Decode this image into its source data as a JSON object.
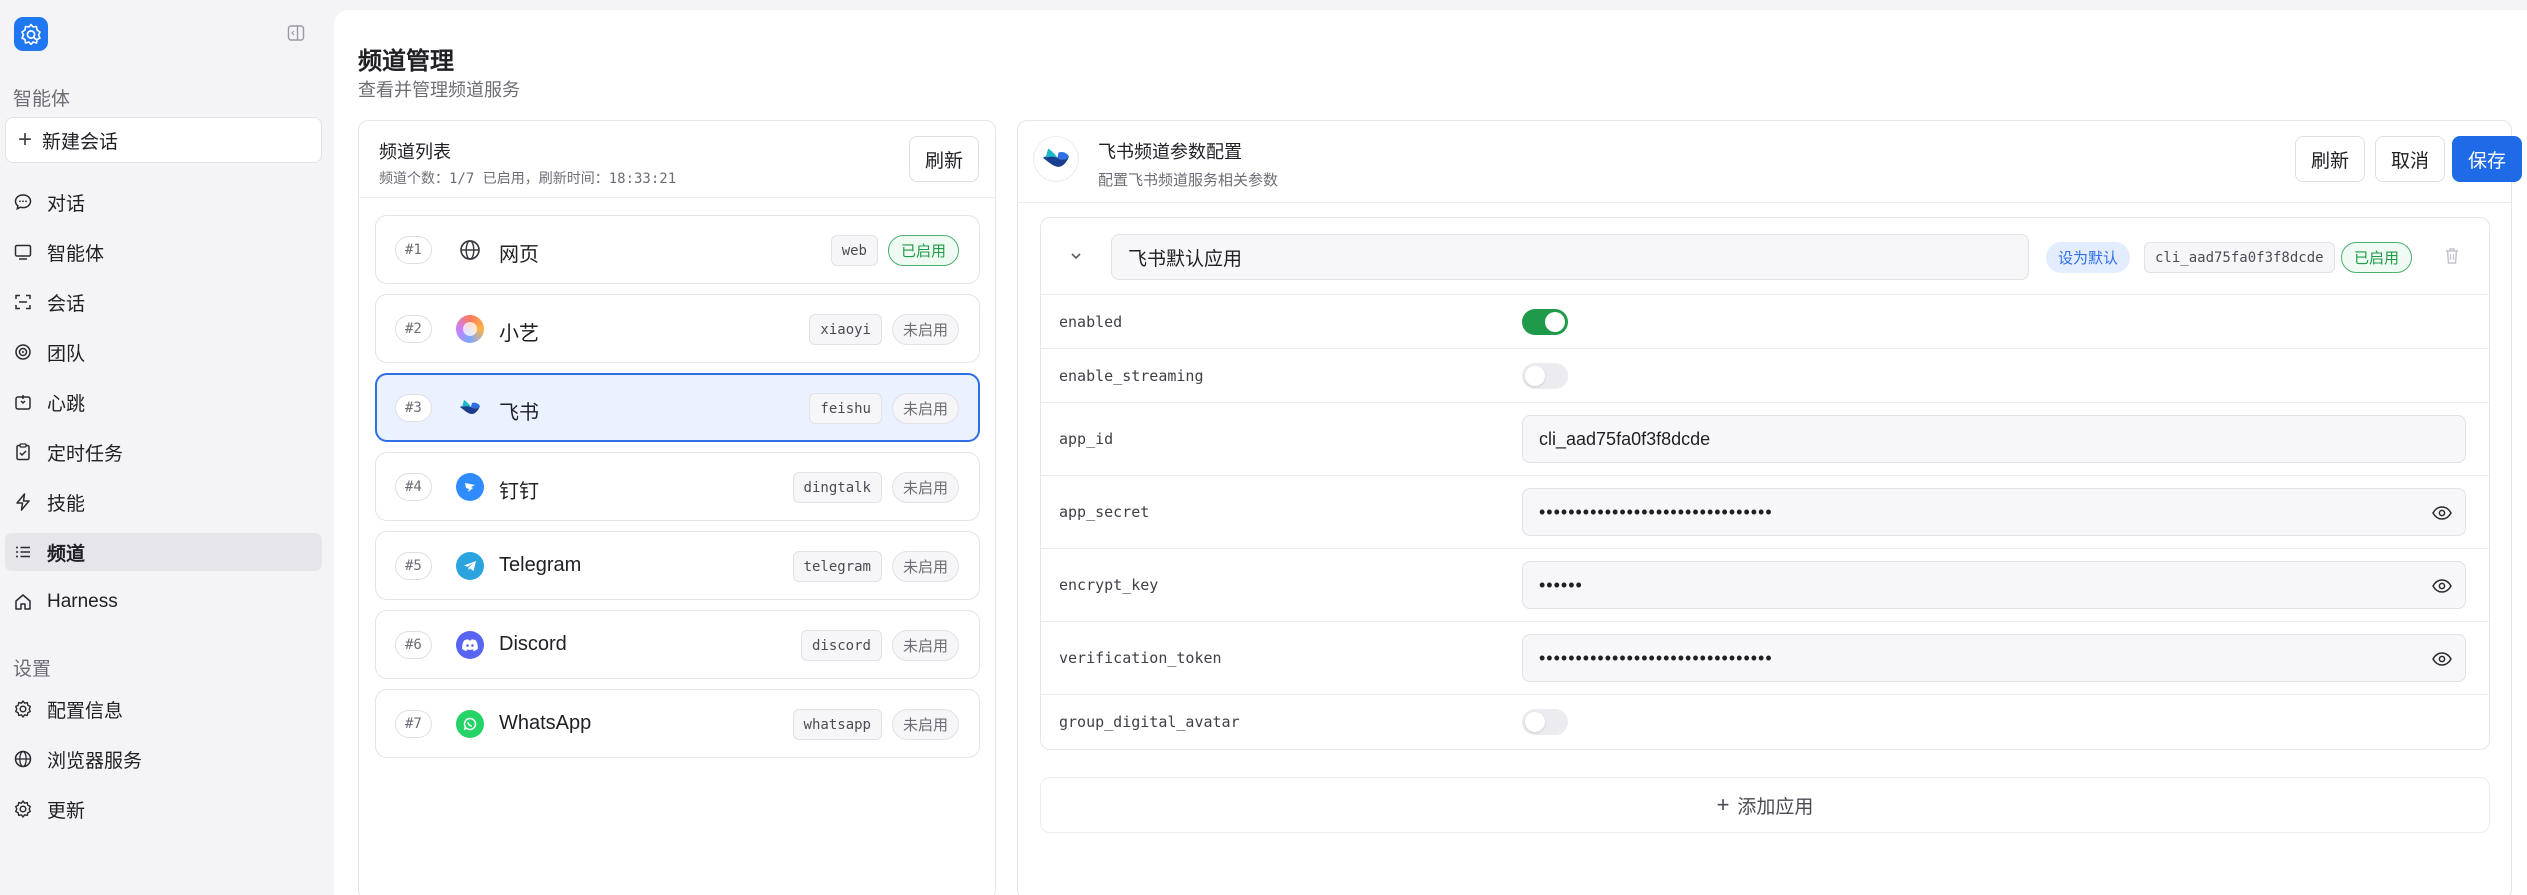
{
  "sidebar": {
    "section_agent": "智能体",
    "new_chat": "新建会话",
    "items": [
      {
        "label": "对话",
        "icon": "chat-icon"
      },
      {
        "label": "智能体",
        "icon": "monitor-icon"
      },
      {
        "label": "会话",
        "icon": "session-icon"
      },
      {
        "label": "团队",
        "icon": "team-icon"
      },
      {
        "label": "心跳",
        "icon": "heartbeat-icon"
      },
      {
        "label": "定时任务",
        "icon": "clipboard-icon"
      },
      {
        "label": "技能",
        "icon": "bolt-icon"
      },
      {
        "label": "频道",
        "icon": "list-icon",
        "active": true
      },
      {
        "label": "Harness",
        "icon": "home-icon"
      }
    ],
    "section_settings": "设置",
    "settings_items": [
      {
        "label": "配置信息",
        "icon": "gear-icon"
      },
      {
        "label": "浏览器服务",
        "icon": "globe-icon"
      },
      {
        "label": "更新",
        "icon": "gear-icon"
      }
    ]
  },
  "page": {
    "title": "频道管理",
    "subtitle": "查看并管理频道服务"
  },
  "channel_list": {
    "title": "频道列表",
    "meta": "频道个数：1/7 已启用，刷新时间：18:33:21",
    "refresh_label": "刷新",
    "channels": [
      {
        "num": "#1",
        "name": "网页",
        "code": "web",
        "status": "已启用",
        "enabled": true
      },
      {
        "num": "#2",
        "name": "小艺",
        "code": "xiaoyi",
        "status": "未启用",
        "enabled": false
      },
      {
        "num": "#3",
        "name": "飞书",
        "code": "feishu",
        "status": "未启用",
        "enabled": false,
        "selected": true
      },
      {
        "num": "#4",
        "name": "钉钉",
        "code": "dingtalk",
        "status": "未启用",
        "enabled": false
      },
      {
        "num": "#5",
        "name": "Telegram",
        "code": "telegram",
        "status": "未启用",
        "enabled": false
      },
      {
        "num": "#6",
        "name": "Discord",
        "code": "discord",
        "status": "未启用",
        "enabled": false
      },
      {
        "num": "#7",
        "name": "WhatsApp",
        "code": "whatsapp",
        "status": "未启用",
        "enabled": false
      }
    ]
  },
  "config": {
    "title": "飞书频道参数配置",
    "subtitle": "配置飞书频道服务相关参数",
    "refresh_label": "刷新",
    "cancel_label": "取消",
    "save_label": "保存",
    "app": {
      "name": "飞书默认应用",
      "set_default": "设为默认",
      "app_id_tag": "cli_aad75fa0f3f8dcde",
      "status": "已启用"
    },
    "fields": {
      "enabled": {
        "label": "enabled",
        "value": true
      },
      "enable_streaming": {
        "label": "enable_streaming",
        "value": false
      },
      "app_id": {
        "label": "app_id",
        "value": "cli_aad75fa0f3f8dcde"
      },
      "app_secret": {
        "label": "app_secret",
        "value": "••••••••••••••••••••••••••••••••"
      },
      "encrypt_key": {
        "label": "encrypt_key",
        "value": "••••••"
      },
      "verification_token": {
        "label": "verification_token",
        "value": "••••••••••••••••••••••••••••••••"
      },
      "group_digital_avatar": {
        "label": "group_digital_avatar",
        "value": false
      }
    },
    "add_app_label": "添加应用"
  },
  "colors": {
    "accent": "#1f6ae6",
    "enabled_green": "#1f9a4a",
    "selected_bg": "#eaf1ff"
  }
}
